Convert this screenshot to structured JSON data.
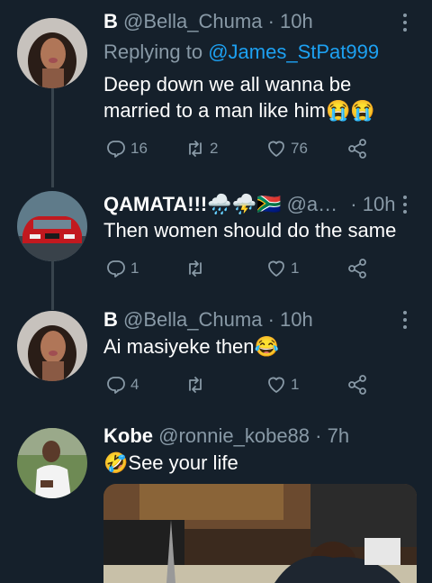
{
  "tweets": [
    {
      "name": "B",
      "handle": "@Bella_Chuma",
      "time": "10h",
      "reply_prefix": "Replying to",
      "reply_to": "@James_StPat999",
      "text": "Deep down we all wanna be married to a man like him😭😭",
      "replies": "16",
      "retweets": "2",
      "likes": "76",
      "avatar": "woman-portrait"
    },
    {
      "name": "QAMATA!!!🌧️⛈️🇿🇦",
      "handle": "@a…",
      "time": "10h",
      "text": "Then women should do the same",
      "replies": "1",
      "retweets": "",
      "likes": "1",
      "avatar": "red-car"
    },
    {
      "name": "B",
      "handle": "@Bella_Chuma",
      "time": "10h",
      "text": "Ai masiyeke then😂",
      "replies": "4",
      "retweets": "",
      "likes": "1",
      "avatar": "woman-portrait"
    },
    {
      "name": "Kobe",
      "handle": "@ronnie_kobe88",
      "time": "7h",
      "text": "🤣See your life",
      "avatar": "man-portrait",
      "media": "photo-parliament"
    }
  ],
  "separator": "·",
  "colors": {
    "background": "#15202b",
    "secondary_text": "#8899a6",
    "link": "#1da1f2",
    "thread_line": "#38444d"
  },
  "icons": [
    "reply-icon",
    "retweet-icon",
    "like-icon",
    "share-icon",
    "more-icon"
  ]
}
